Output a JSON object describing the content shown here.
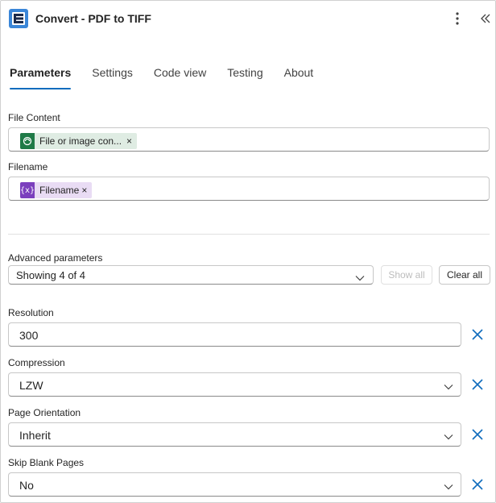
{
  "header": {
    "title": "Convert - PDF to TIFF",
    "logo_icon": "encodian-logo-icon",
    "more_icon": "more-vertical-icon",
    "collapse_icon": "double-chevron-left-icon"
  },
  "tabs": [
    {
      "label": "Parameters",
      "active": true
    },
    {
      "label": "Settings",
      "active": false
    },
    {
      "label": "Code view",
      "active": false
    },
    {
      "label": "Testing",
      "active": false
    },
    {
      "label": "About",
      "active": false
    }
  ],
  "file_content": {
    "label": "File Content",
    "token_label": "File or image con...",
    "token_remove": "×",
    "token_icon": "sharepoint-icon"
  },
  "filename": {
    "label": "Filename",
    "token_label": "Filename",
    "token_remove": "×",
    "token_icon_text": "{x}"
  },
  "advanced": {
    "label": "Advanced parameters",
    "select_value": "Showing 4 of 4",
    "show_all_label": "Show all",
    "clear_all_label": "Clear all"
  },
  "params": {
    "resolution": {
      "label": "Resolution",
      "value": "300"
    },
    "compression": {
      "label": "Compression",
      "value": "LZW"
    },
    "orientation": {
      "label": "Page Orientation",
      "value": "Inherit"
    },
    "skip_blank": {
      "label": "Skip Blank Pages",
      "value": "No"
    }
  },
  "colors": {
    "accent": "#0f6cbd",
    "remove_x": "#0f6cbd",
    "logo_bg": "#3a86d8",
    "green_chip_bg": "#dfece3",
    "purple_chip_bg": "#e9dcf4"
  }
}
